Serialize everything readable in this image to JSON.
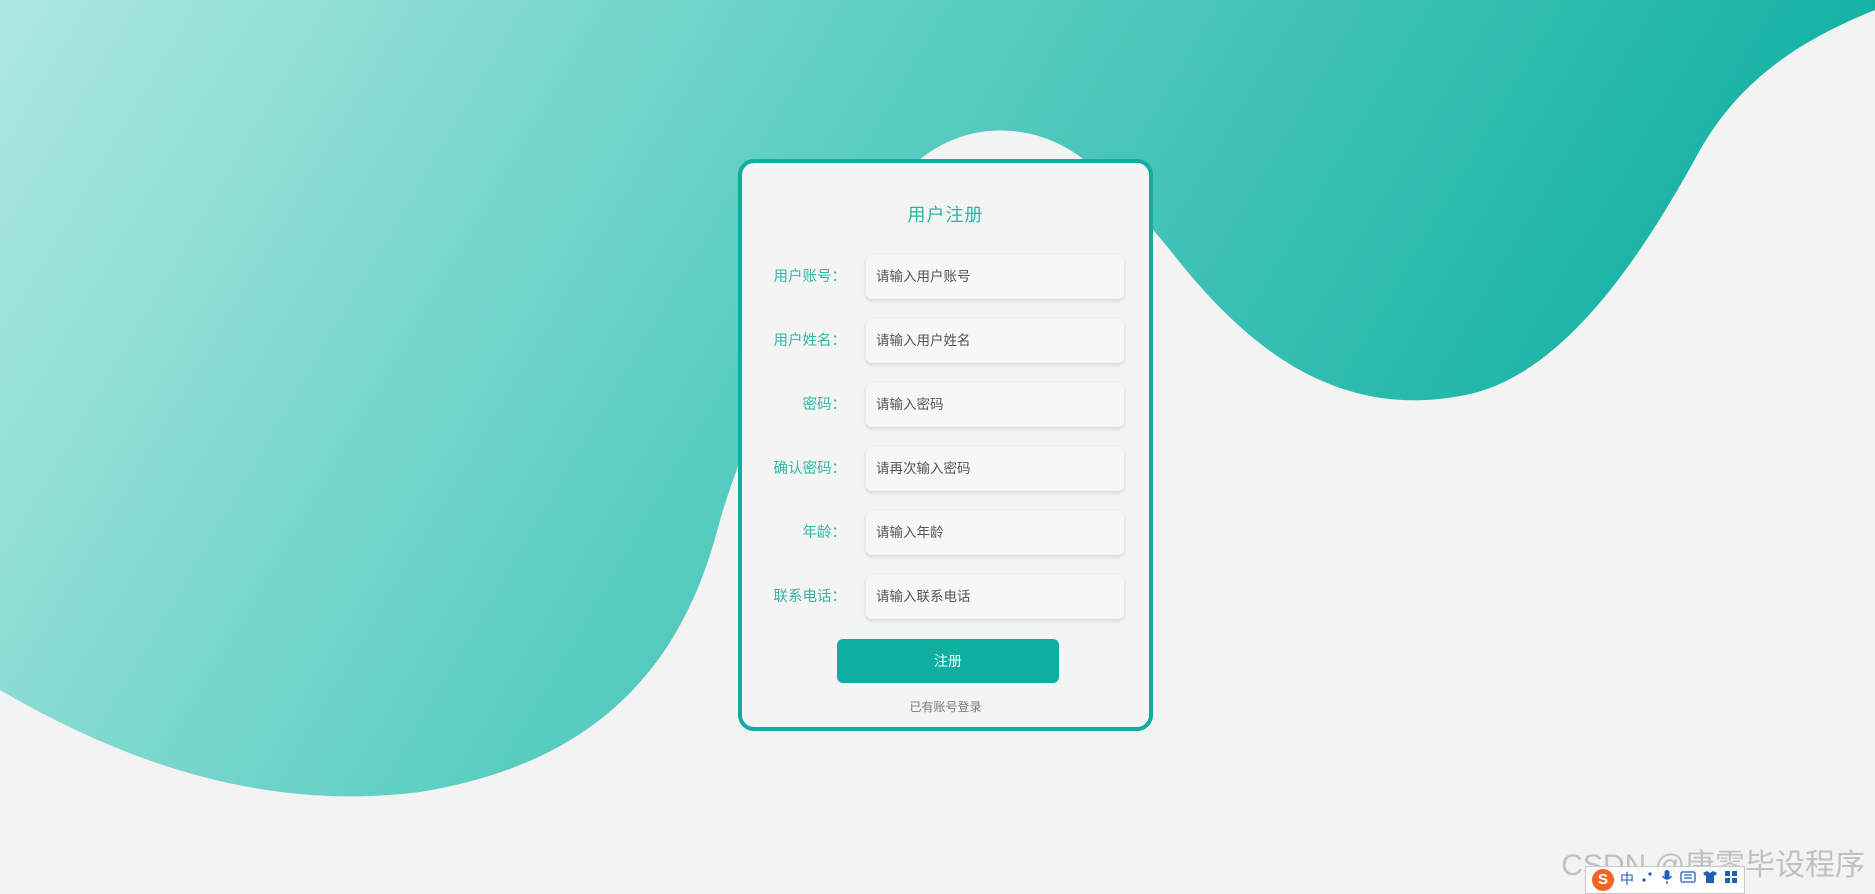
{
  "colors": {
    "accent": "#0eafa1",
    "label": "#35b5a6",
    "background": "#f3f3f3",
    "wave_light": "#aee8e2",
    "wave_dark": "#0eafa1"
  },
  "form": {
    "title": "用户注册",
    "fields": [
      {
        "label": "用户账号：",
        "placeholder": "请输入用户账号"
      },
      {
        "label": "用户姓名：",
        "placeholder": "请输入用户姓名"
      },
      {
        "label": "密码：",
        "placeholder": "请输入密码"
      },
      {
        "label": "确认密码：",
        "placeholder": "请再次输入密码"
      },
      {
        "label": "年龄：",
        "placeholder": "请输入年龄"
      },
      {
        "label": "联系电话：",
        "placeholder": "请输入联系电话"
      }
    ],
    "submit_label": "注册",
    "login_link": "已有账号登录"
  },
  "watermark": "CSDN @唐零毕设程序",
  "ime_toolbar": {
    "logo": "S",
    "mode": "中",
    "icons": [
      "punctuation-icon",
      "microphone-icon",
      "keyboard-icon",
      "skin-icon",
      "toolbox-icon"
    ]
  }
}
